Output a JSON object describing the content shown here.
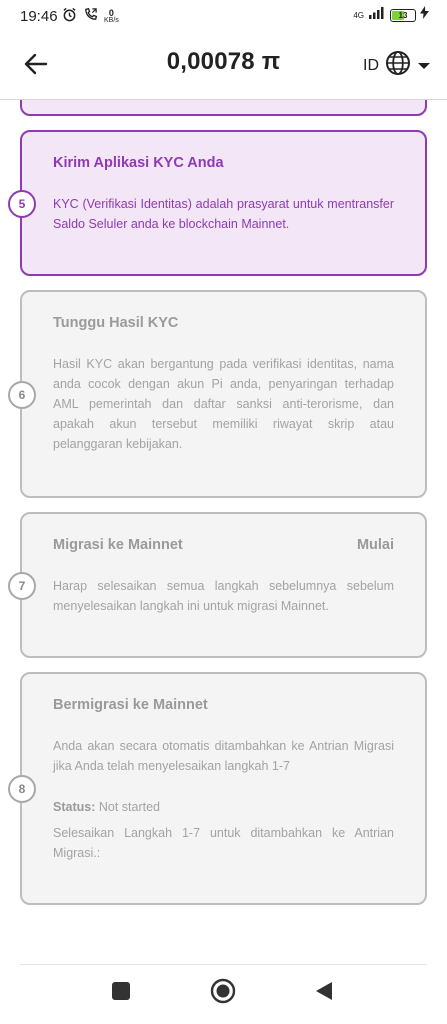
{
  "status_bar": {
    "time": "19:46",
    "net_speed_value": "0",
    "net_speed_unit": "KB/s",
    "network": "4G",
    "battery": "13",
    "icons": [
      "alarm-icon",
      "call-icon",
      "signal-icon",
      "battery-icon",
      "charging-icon"
    ]
  },
  "header": {
    "balance": "0,00078 π",
    "lang_code": "ID",
    "icons": [
      "back-arrow-icon",
      "globe-icon",
      "caret-down-icon"
    ]
  },
  "steps": [
    {
      "number": "5",
      "title": "Kirim Aplikasi KYC Anda",
      "text": "KYC (Verifikasi Identitas) adalah prasyarat untuk mentransfer Saldo Seluler anda ke blockchain Mainnet.",
      "state": "active"
    },
    {
      "number": "6",
      "title": "Tunggu Hasil KYC",
      "text": "Hasil KYC akan bergantung pada verifikasi identitas, nama anda cocok dengan akun Pi anda, penyaringan terhadap AML pemerintah dan daftar sanksi anti-terorisme, dan apakah akun tersebut memiliki riwayat skrip atau pelanggaran kebijakan.",
      "state": "inactive"
    },
    {
      "number": "7",
      "title": "Migrasi ke Mainnet",
      "action": "Mulai",
      "text": "Harap selesaikan semua langkah sebelumnya sebelum menyelesaikan langkah ini untuk migrasi Mainnet.",
      "state": "inactive"
    },
    {
      "number": "8",
      "title": "Bermigrasi ke Mainnet",
      "text": "Anda akan secara otomatis ditambahkan ke Antrian Migrasi jika Anda telah menyelesaikan langkah 1-7",
      "status_label": "Status:",
      "status_value": "Not started",
      "note": "Selesaikan Langkah 1-7 untuk ditambahkan ke Antrian Migrasi.:",
      "state": "inactive"
    }
  ],
  "colors": {
    "accent": "#8e3bb3",
    "active_bg": "#f3e6f6",
    "inactive_bg": "#f4f4f4",
    "inactive_border": "#bdbdbd"
  },
  "nav": {
    "icons": [
      "recent-apps-icon",
      "home-icon",
      "back-icon"
    ]
  }
}
